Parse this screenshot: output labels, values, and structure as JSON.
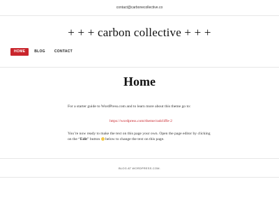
{
  "top_bar": {
    "email": "contact@carbonecollective.co"
  },
  "header": {
    "site_title": "+ + + carbon collective + + +"
  },
  "nav": {
    "items": [
      {
        "label": "HOME",
        "active": true
      },
      {
        "label": "BLOG",
        "active": false
      },
      {
        "label": "CONTACT",
        "active": false
      }
    ]
  },
  "page": {
    "title": "Home",
    "paragraph1": "For a starter guide to WordPress.com and to learn more about this theme go to:",
    "link": "https://wordpress.com/theme/radcliffe-2",
    "paragraph2_before": "You’re now ready to make the text on this page your own. Open the page editor by clicking on the “",
    "paragraph2_edit": "Edit",
    "paragraph2_after_edit": "” button",
    "paragraph2_end": "below to change the text on this page."
  },
  "footer": {
    "text": "BLOG AT WORDPRESS.COM."
  },
  "colors": {
    "accent": "#c9252c",
    "text": "#222222",
    "divider": "#e6e6e6"
  },
  "icons": {
    "edit_button_icon": "pencil-icon"
  }
}
